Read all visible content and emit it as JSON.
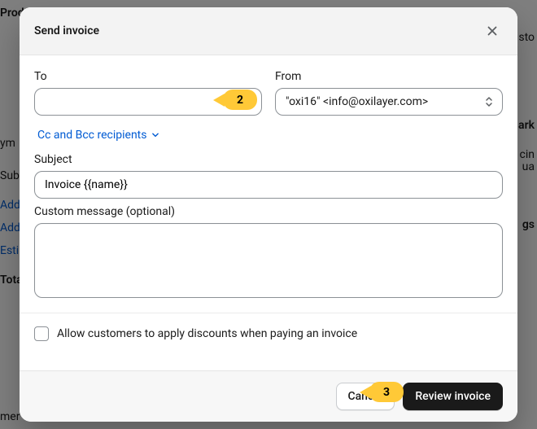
{
  "modal": {
    "title": "Send invoice",
    "to_label": "To",
    "from_label": "From",
    "from_value": "\"oxi16\" <info@oxilayer.com>",
    "cc_label": "Cc and Bcc recipients",
    "subject_label": "Subject",
    "subject_value": "Invoice {{name}}",
    "message_label": "Custom message (optional)",
    "discount_checkbox_label": "Allow customers to apply discounts when paying an invoice",
    "cancel_label": "Cancel",
    "review_label": "Review invoice"
  },
  "step_markers": {
    "two": "2",
    "three": "3"
  },
  "background": {
    "prod": "Produ",
    "sub": "Sub",
    "add1": "Add",
    "add2": "Add",
    "esti": "Esti",
    "tota": "Tota",
    "sto": "sto",
    "ark": "ark",
    "cin": "cin",
    "ua": "ua",
    "gs": "gs",
    "ym": "ym",
    "mer": "mer"
  }
}
